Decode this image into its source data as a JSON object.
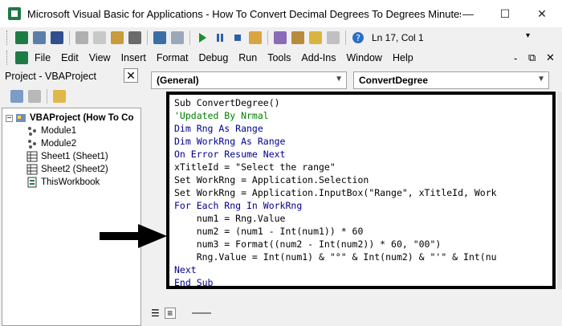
{
  "window": {
    "title": "Microsoft Visual Basic for Applications - How To Convert Decimal Degrees To Degrees Minutes Sec...",
    "minimize": "—",
    "maximize": "☐",
    "close": "✕"
  },
  "toolbar": {
    "status": "Ln 17, Col 1"
  },
  "menu": {
    "items": [
      "File",
      "Edit",
      "View",
      "Insert",
      "Format",
      "Debug",
      "Run",
      "Tools",
      "Add-Ins",
      "Window",
      "Help"
    ],
    "minimize": "-",
    "restore": "⧉",
    "close": "✕"
  },
  "project": {
    "header": "Project - VBAProject",
    "close": "✕",
    "tree": [
      {
        "label": "VBAProject (How To Co",
        "level": 0,
        "icon": "vbaproject-icon"
      },
      {
        "label": "Module1",
        "level": 1,
        "icon": "module-icon"
      },
      {
        "label": "Module2",
        "level": 1,
        "icon": "module-icon"
      },
      {
        "label": "Sheet1 (Sheet1)",
        "level": 1,
        "icon": "sheet-icon"
      },
      {
        "label": "Sheet2 (Sheet2)",
        "level": 1,
        "icon": "sheet-icon"
      },
      {
        "label": "ThisWorkbook",
        "level": 1,
        "icon": "workbook-icon"
      }
    ]
  },
  "editor": {
    "object_combo": "(General)",
    "proc_combo": "ConvertDegree",
    "lines": [
      "Sub ConvertDegree()",
      "'Updated By Nrmal",
      "Dim Rng As Range",
      "Dim WorkRng As Range",
      "On Error Resume Next",
      "xTitleId = \"Select the range\"",
      "Set WorkRng = Application.Selection",
      "Set WorkRng = Application.InputBox(\"Range\", xTitleId, Work",
      "For Each Rng In WorkRng",
      "    num1 = Rng.Value",
      "    num2 = (num1 - Int(num1)) * 60",
      "    num3 = Format((num2 - Int(num2)) * 60, \"00\")",
      "    Rng.Value = Int(num1) & \"°\" & Int(num2) & \"'\" & Int(nu",
      "Next",
      "End Sub"
    ]
  },
  "colors": {
    "keyword": "#00008b",
    "comment": "#008000",
    "annotation_border": "#000000"
  }
}
